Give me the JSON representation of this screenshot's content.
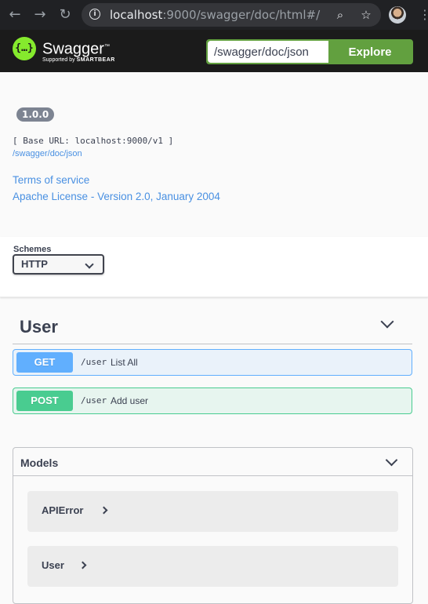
{
  "browser": {
    "url_host": "localhost",
    "url_rest": ":9000/swagger/doc/html#/",
    "back_icon": "←",
    "forward_icon": "→",
    "reload_icon": "↻",
    "info_icon": "i",
    "zoom_icon": "⌕",
    "star_icon": "☆",
    "menu_icon": "⋮"
  },
  "topbar": {
    "logo_glyph": "{…}",
    "logo_text": "Swagger",
    "logo_tm": "™",
    "logo_sub_prefix": "Supported by ",
    "logo_sub_brand": "SMARTBEAR",
    "spec_url_value": "/swagger/doc/json",
    "explore_label": "Explore"
  },
  "info": {
    "version": "1.0.0",
    "base_url": "[ Base URL: localhost:9000/v1 ]",
    "spec_link": "/swagger/doc/json",
    "terms_link": "Terms of service",
    "license_link": "Apache License - Version 2.0, January 2004"
  },
  "schemes": {
    "label": "Schemes",
    "selected": "HTTP"
  },
  "tag": {
    "name": "User",
    "operations": [
      {
        "method": "GET",
        "path": "/user",
        "summary": "List All"
      },
      {
        "method": "POST",
        "path": "/user",
        "summary": "Add user"
      }
    ]
  },
  "models": {
    "title": "Models",
    "items": [
      "APIError",
      "User"
    ]
  },
  "colors": {
    "get": "#61affe",
    "post": "#49cc90",
    "explore": "#62a03f",
    "link": "#4990e2"
  }
}
